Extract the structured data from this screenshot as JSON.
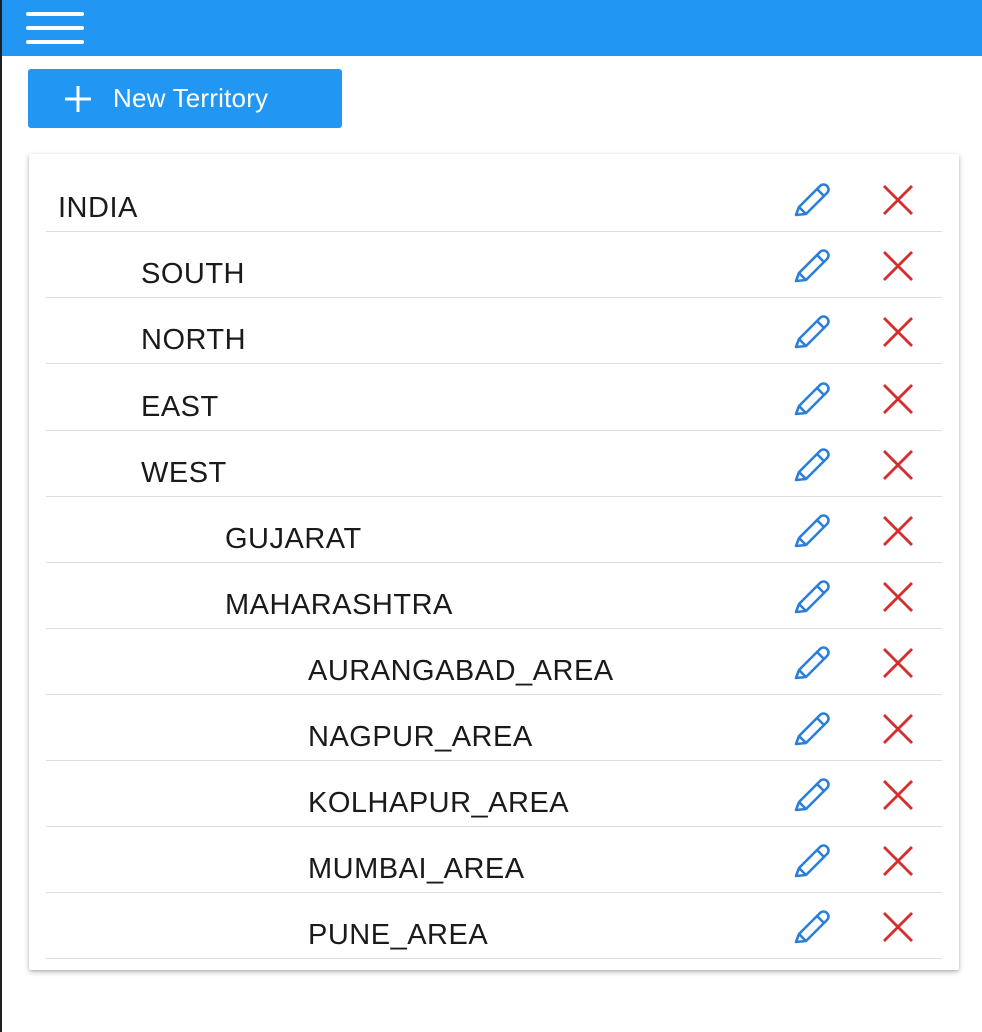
{
  "toolbar": {
    "menu_icon": "hamburger-menu-icon",
    "new_button_label": "New Territory",
    "new_button_icon": "plus-icon"
  },
  "colors": {
    "primary": "#2196f3",
    "edit_icon": "#2b7fd9",
    "delete_icon": "#d32f2f"
  },
  "territories": [
    {
      "name": "INDIA",
      "level": 0
    },
    {
      "name": "SOUTH",
      "level": 1
    },
    {
      "name": "NORTH",
      "level": 1
    },
    {
      "name": "EAST",
      "level": 1
    },
    {
      "name": "WEST",
      "level": 1
    },
    {
      "name": "GUJARAT",
      "level": 2
    },
    {
      "name": "MAHARASHTRA",
      "level": 2
    },
    {
      "name": "AURANGABAD_AREA",
      "level": 3
    },
    {
      "name": "NAGPUR_AREA",
      "level": 3
    },
    {
      "name": "KOLHAPUR_AREA",
      "level": 3
    },
    {
      "name": "MUMBAI_AREA",
      "level": 3
    },
    {
      "name": "PUNE_AREA",
      "level": 3
    }
  ],
  "row_actions": {
    "edit_icon": "pencil-icon",
    "delete_icon": "close-icon"
  }
}
